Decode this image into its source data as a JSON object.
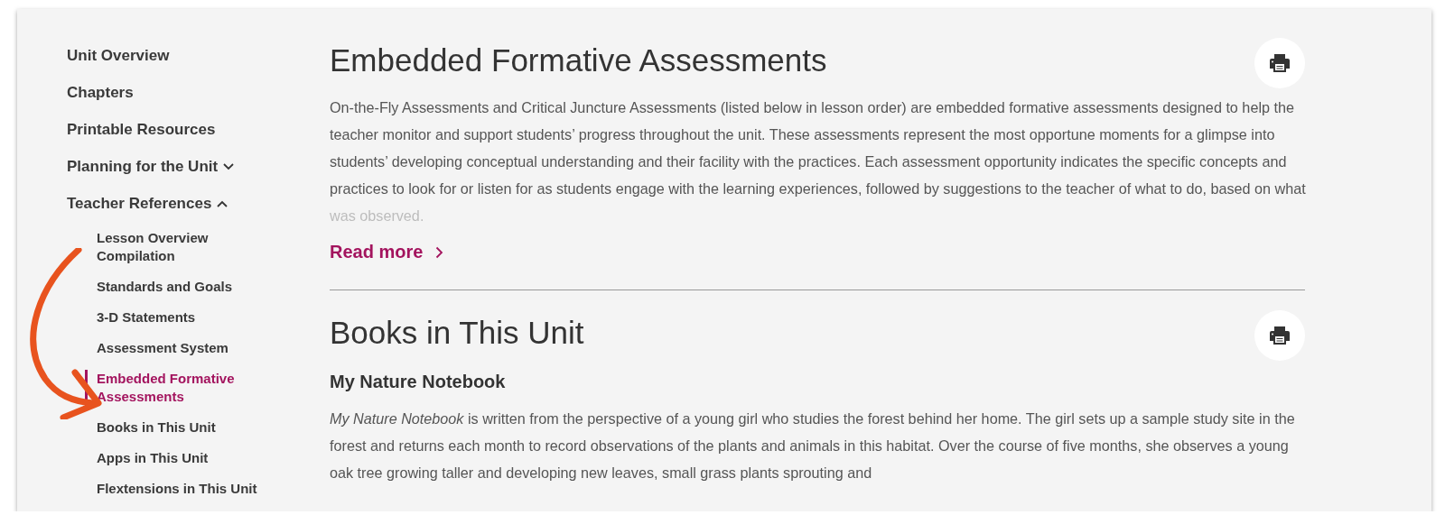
{
  "sidebar": {
    "items": [
      {
        "label": "Unit Overview",
        "kind": "link"
      },
      {
        "label": "Chapters",
        "kind": "link"
      },
      {
        "label": "Printable Resources",
        "kind": "link"
      },
      {
        "label": "Planning for the Unit",
        "kind": "group",
        "expanded": false
      },
      {
        "label": "Teacher References",
        "kind": "group",
        "expanded": true,
        "children": [
          {
            "label": "Lesson Overview Compilation",
            "selected": false
          },
          {
            "label": "Standards and Goals",
            "selected": false
          },
          {
            "label": "3-D Statements",
            "selected": false
          },
          {
            "label": "Assessment System",
            "selected": false
          },
          {
            "label": "Embedded Formative Assessments",
            "selected": true
          },
          {
            "label": "Books in This Unit",
            "selected": false
          },
          {
            "label": "Apps in This Unit",
            "selected": false
          },
          {
            "label": "Flextensions in This Unit",
            "selected": false
          }
        ]
      }
    ]
  },
  "sections": [
    {
      "title": "Embedded Formative Assessments",
      "text": "On-the-Fly Assessments and Critical Juncture Assessments (listed below in lesson order) are embedded formative assessments designed to help the teacher monitor and support students’ progress throughout the unit. These assessments represent the most opportune moments for a glimpse into students’ developing conceptual understanding and their facility with the practices. Each assessment opportunity indicates the specific concepts and practices to look for or listen for as students engage with the learning experiences, followed by suggestions to the teacher of what to do, based on what was observed.",
      "expanded": false,
      "read_more": "Read more"
    },
    {
      "title": "Books in This Unit",
      "books": [
        {
          "title": "My Nature Notebook",
          "text": "*My Nature Notebook* is written from the perspective of a young girl who studies the forest behind her home. The girl sets up a sample study site in the forest and returns each month to record observations of the plants and animals in this habitat. Over the course of five months, she observes a young oak tree growing taller and developing new leaves, small grass plants sprouting and"
        }
      ]
    }
  ]
}
